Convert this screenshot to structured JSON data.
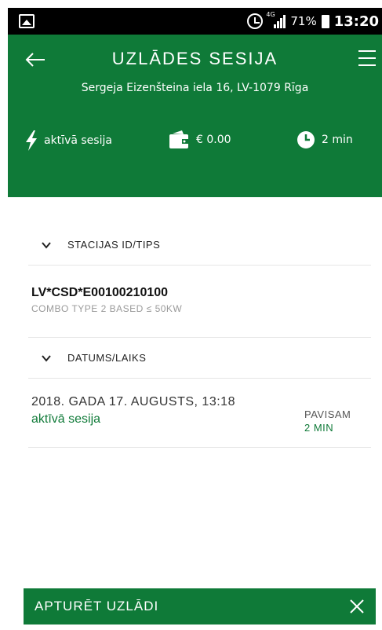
{
  "status_bar": {
    "network": "4G",
    "battery_percent": "71%",
    "time": "13:20",
    "icons": [
      "image-icon",
      "alarm-icon",
      "signal-icon",
      "battery-icon"
    ]
  },
  "header": {
    "title": "UZLĀDES SESIJA",
    "address": "Sergeja Eizenšteina iela 16, LV-1079 Rīga",
    "background_color": "#0f7a38",
    "stats": {
      "session_label": "aktīvā sesija",
      "cost": "€ 0.00",
      "duration": "2 min"
    }
  },
  "station_section": {
    "heading": "STACIJAS ID/TIPS",
    "station_id": "LV*CSD*E00100210100",
    "station_type": "COMBO TYPE 2 BASED ≤ 50KW"
  },
  "datetime_section": {
    "heading": "DATUMS/LAIKS",
    "date": "2018. GADA 17. AUGUSTS, 13:18",
    "status": "aktīvā sesija",
    "total_label": "PAVISAM",
    "total_value": "2 MIN"
  },
  "stop_bar": {
    "label": "APTURĒT UZLĀDI"
  }
}
